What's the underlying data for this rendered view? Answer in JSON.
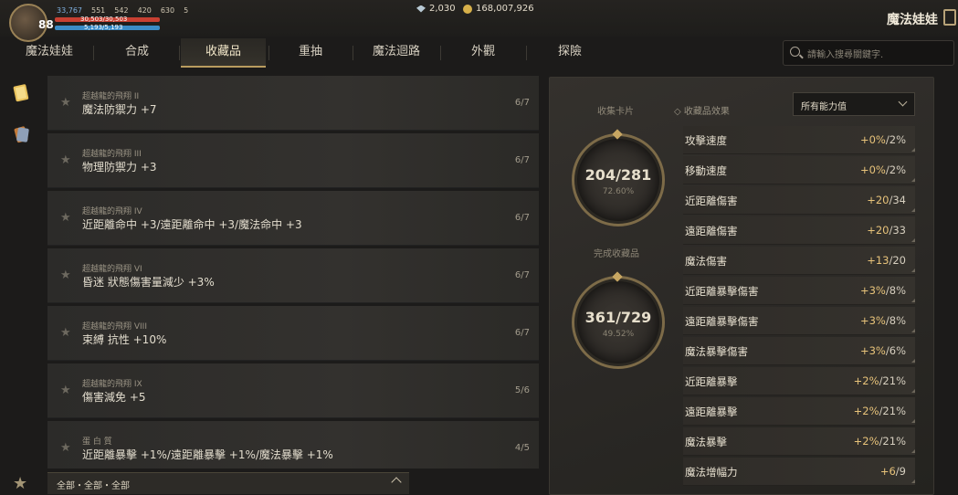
{
  "header": {
    "level": "88",
    "stats": [
      "33,767",
      "551",
      "542",
      "420",
      "630",
      "5"
    ],
    "hp_text": "30,503/30,503",
    "mp_text": "5,193/5,193",
    "diamonds": "2,030",
    "gold": "168,007,926",
    "app_title": "魔法娃娃"
  },
  "tabs": [
    {
      "label": "魔法娃娃"
    },
    {
      "label": "合成"
    },
    {
      "label": "收藏品"
    },
    {
      "label": "重抽"
    },
    {
      "label": "魔法迴路"
    },
    {
      "label": "外觀"
    },
    {
      "label": "探險"
    }
  ],
  "search": {
    "placeholder": "請輸入搜尋關鍵字."
  },
  "list": [
    {
      "sub": "超越龍的飛翔 II",
      "main": "魔法防禦力 +7",
      "count": "6/7"
    },
    {
      "sub": "超越龍的飛翔 III",
      "main": "物理防禦力 +3",
      "count": "6/7"
    },
    {
      "sub": "超越龍的飛翔 IV",
      "main": "近距離命中 +3/遠距離命中 +3/魔法命中 +3",
      "count": "6/7"
    },
    {
      "sub": "超越龍的飛翔 VI",
      "main": "昏迷 狀態傷害量減少 +3%",
      "count": "6/7"
    },
    {
      "sub": "超越龍的飛翔 VIII",
      "main": "束縛 抗性 +10%",
      "count": "6/7"
    },
    {
      "sub": "超越龍的飛翔 IX",
      "main": "傷害減免 +5",
      "count": "5/6"
    },
    {
      "sub": "蛋 白 質",
      "main": "近距離暴擊 +1%/遠距離暴擊 +1%/魔法暴擊 +1%",
      "count": "4/5"
    }
  ],
  "filter": {
    "text": "全部・全部・全部"
  },
  "panel": {
    "cards_label": "收集卡片",
    "cards_value": "204/281",
    "cards_pct": "72.60%",
    "done_label": "完成收藏品",
    "done_value": "361/729",
    "done_pct": "49.52%",
    "effects_label": "收藏品效果",
    "dropdown": "所有能力值",
    "effects": [
      {
        "name": "攻擊速度",
        "cur": "+0%",
        "max": "/2%"
      },
      {
        "name": "移動速度",
        "cur": "+0%",
        "max": "/2%"
      },
      {
        "name": "近距離傷害",
        "cur": "+20",
        "max": "/34"
      },
      {
        "name": "遠距離傷害",
        "cur": "+20",
        "max": "/33"
      },
      {
        "name": "魔法傷害",
        "cur": "+13",
        "max": "/20"
      },
      {
        "name": "近距離暴擊傷害",
        "cur": "+3%",
        "max": "/8%"
      },
      {
        "name": "遠距離暴擊傷害",
        "cur": "+3%",
        "max": "/8%"
      },
      {
        "name": "魔法暴擊傷害",
        "cur": "+3%",
        "max": "/6%"
      },
      {
        "name": "近距離暴擊",
        "cur": "+2%",
        "max": "/21%"
      },
      {
        "name": "遠距離暴擊",
        "cur": "+2%",
        "max": "/21%"
      },
      {
        "name": "魔法暴擊",
        "cur": "+2%",
        "max": "/21%"
      },
      {
        "name": "魔法增幅力",
        "cur": "+6",
        "max": "/9"
      }
    ]
  }
}
